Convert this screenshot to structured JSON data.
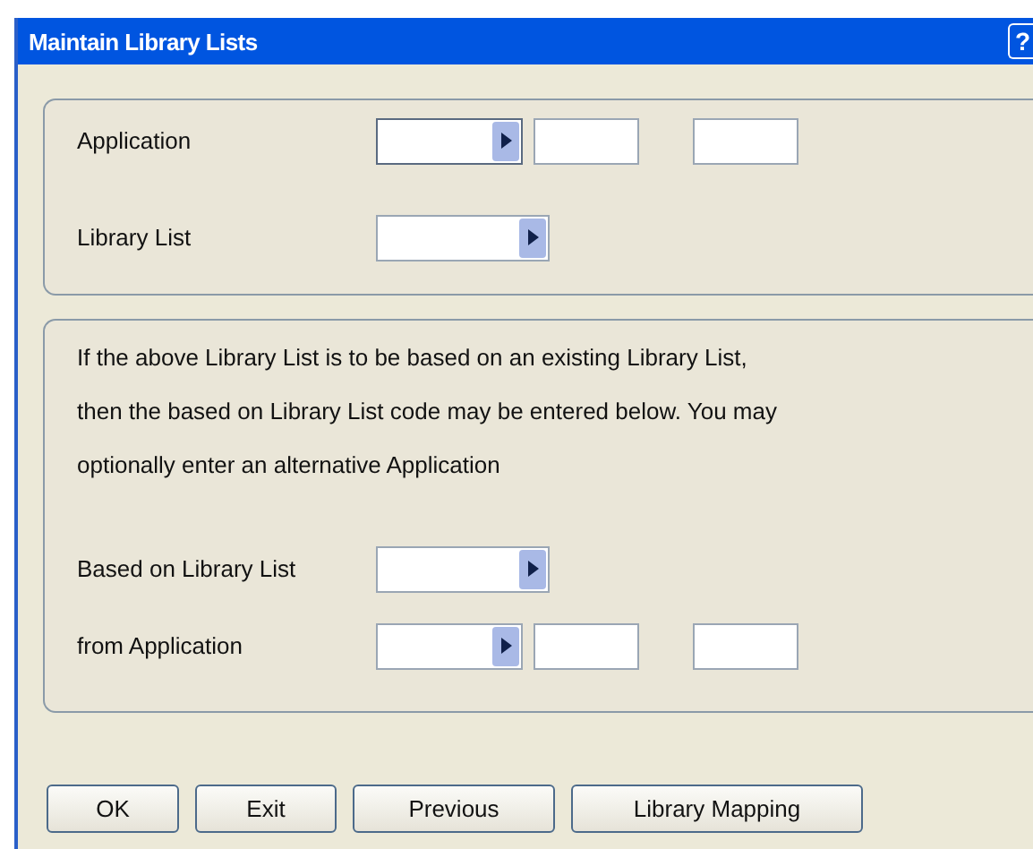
{
  "window": {
    "title": "Maintain Library Lists",
    "help": "?"
  },
  "panel1": {
    "rows": [
      {
        "label": "Application",
        "fields": [
          {
            "kind": "lookup",
            "focused": true
          },
          {
            "kind": "text",
            "focused": false
          },
          {
            "kind": "text",
            "focused": false
          }
        ]
      },
      {
        "label": "Library List",
        "fields": [
          {
            "kind": "lookup-wide",
            "focused": false
          }
        ]
      }
    ]
  },
  "panel2": {
    "note_lines": [
      "If the above Library List is to be based on an existing Library List,",
      "then the based on Library List code may be entered below.  You may",
      "optionally enter an alternative Application"
    ],
    "rows": [
      {
        "label": "Based on Library List",
        "fields": [
          {
            "kind": "lookup-wide",
            "focused": false
          }
        ]
      },
      {
        "label": "from Application",
        "fields": [
          {
            "kind": "lookup",
            "focused": false
          },
          {
            "kind": "text",
            "focused": false
          },
          {
            "kind": "text",
            "focused": false
          }
        ]
      }
    ]
  },
  "buttons": [
    "OK",
    "Exit",
    "Previous",
    "Library Mapping"
  ]
}
